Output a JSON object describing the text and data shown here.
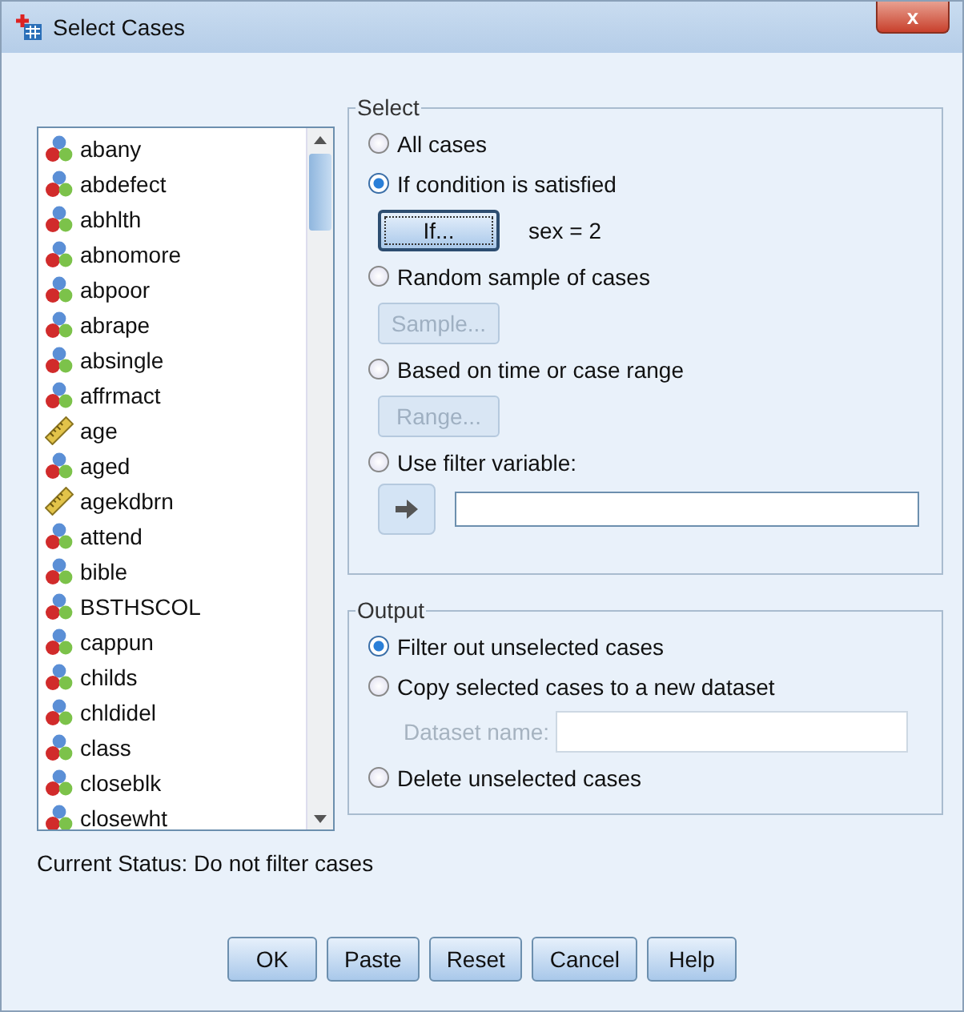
{
  "window": {
    "title": "Select Cases",
    "close": "x"
  },
  "variables": [
    {
      "name": "abany",
      "kind": "nominal"
    },
    {
      "name": "abdefect",
      "kind": "nominal"
    },
    {
      "name": "abhlth",
      "kind": "nominal"
    },
    {
      "name": "abnomore",
      "kind": "nominal"
    },
    {
      "name": "abpoor",
      "kind": "nominal"
    },
    {
      "name": "abrape",
      "kind": "nominal"
    },
    {
      "name": "absingle",
      "kind": "nominal"
    },
    {
      "name": "affrmact",
      "kind": "nominal"
    },
    {
      "name": "age",
      "kind": "scale"
    },
    {
      "name": "aged",
      "kind": "nominal"
    },
    {
      "name": "agekdbrn",
      "kind": "scale"
    },
    {
      "name": "attend",
      "kind": "nominal"
    },
    {
      "name": "bible",
      "kind": "nominal"
    },
    {
      "name": "BSTHSCOL",
      "kind": "nominal"
    },
    {
      "name": "cappun",
      "kind": "nominal"
    },
    {
      "name": "childs",
      "kind": "nominal"
    },
    {
      "name": "chldidel",
      "kind": "nominal"
    },
    {
      "name": "class",
      "kind": "nominal"
    },
    {
      "name": "closeblk",
      "kind": "nominal"
    },
    {
      "name": "closewht",
      "kind": "nominal"
    }
  ],
  "select": {
    "legend": "Select",
    "options": [
      {
        "label": "All cases",
        "selected": false
      },
      {
        "label": "If condition is satisfied",
        "selected": true,
        "button": {
          "label": "If...",
          "disabled": false
        },
        "note": "sex = 2"
      },
      {
        "label": "Random sample of cases",
        "selected": false,
        "button": {
          "label": "Sample...",
          "disabled": true
        }
      },
      {
        "label": "Based on time or case range",
        "selected": false,
        "button": {
          "label": "Range...",
          "disabled": true
        }
      },
      {
        "label": "Use filter variable:",
        "selected": false,
        "arrow": true
      }
    ]
  },
  "output": {
    "legend": "Output",
    "options": [
      {
        "label": "Filter out unselected cases",
        "selected": true
      },
      {
        "label": "Copy selected cases to a new dataset",
        "selected": false,
        "field": {
          "label": "Dataset name:",
          "disabled": true
        }
      },
      {
        "label": "Delete unselected cases",
        "selected": false
      }
    ]
  },
  "status": "Current Status: Do not filter cases",
  "buttons": [
    "OK",
    "Paste",
    "Reset",
    "Cancel",
    "Help"
  ]
}
